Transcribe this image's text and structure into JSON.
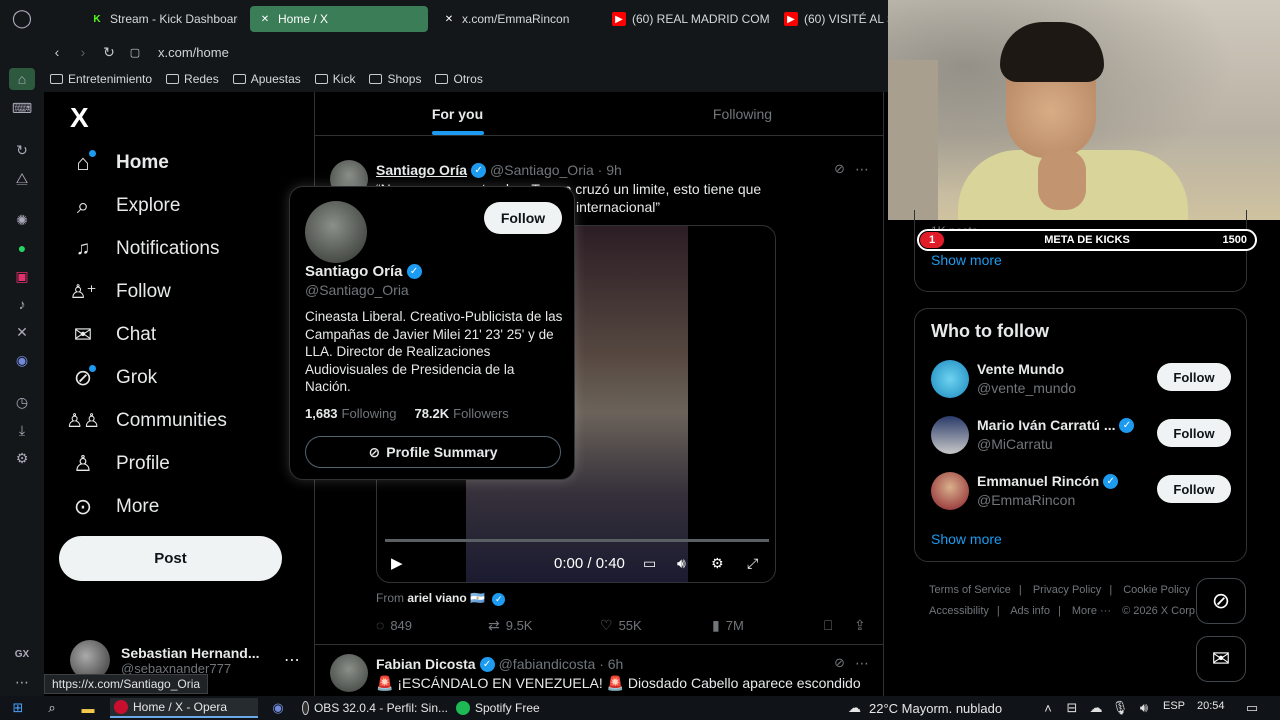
{
  "browser": {
    "tabs": [
      {
        "label": "Stream - Kick Dashboard",
        "icon": "kick-icon",
        "color": "#53fc18"
      },
      {
        "label": "Home / X",
        "icon": "x-icon",
        "color": "#ffffff"
      },
      {
        "label": "x.com/EmmaRincon",
        "icon": "x-icon",
        "color": "#ffffff"
      },
      {
        "label": "(60) REAL MADRID COM",
        "icon": "youtube-icon",
        "color": "#ff0000"
      },
      {
        "label": "(60) VISITÉ AL S",
        "icon": "youtube-icon",
        "color": "#ff0000"
      }
    ],
    "url": "x.com/home",
    "bookmarks": [
      "Entretenimiento",
      "Redes",
      "Apuestas",
      "Kick",
      "Shops",
      "Otros"
    ],
    "status_url": "https://x.com/Santiago_Oria"
  },
  "nav": {
    "logo": "X",
    "items": [
      {
        "label": "Home",
        "icon": "home-icon",
        "glyph": "⌂"
      },
      {
        "label": "Explore",
        "icon": "search-icon",
        "glyph": "⌕"
      },
      {
        "label": "Notifications",
        "icon": "bell-icon",
        "glyph": "🔔︎"
      },
      {
        "label": "Follow",
        "icon": "person-add-icon",
        "glyph": "👤︎"
      },
      {
        "label": "Chat",
        "icon": "mail-icon",
        "glyph": "✉"
      },
      {
        "label": "Grok",
        "icon": "grok-icon",
        "glyph": "⊘"
      },
      {
        "label": "Communities",
        "icon": "communities-icon",
        "glyph": "👥︎"
      },
      {
        "label": "Profile",
        "icon": "profile-icon",
        "glyph": "👤︎"
      },
      {
        "label": "More",
        "icon": "more-circle-icon",
        "glyph": "⋯"
      }
    ],
    "post_button": "Post",
    "account": {
      "name": "Sebastian Hernand...",
      "handle": "@sebaxnander777"
    }
  },
  "feed": {
    "tabs": [
      "For you",
      "Following"
    ],
    "post1": {
      "name": "Santiago Oría",
      "handle": "@Santiago_Oria · 9h",
      "text_line1": "“No se vos no entendes. Trump cruzó un limite, esto tiene que",
      "text_line2": "internacional”",
      "video_time": "0:00 / 0:40",
      "source_label": "From",
      "source_name": "ariel viano 🇦🇷",
      "replies": "849",
      "reposts": "9.5K",
      "likes": "55K",
      "views": "7M"
    },
    "post2": {
      "name": "Fabian Dicosta",
      "handle": "@fabiandicosta · 6h",
      "text": "🚨 ¡ESCÁNDALO EN VENEZUELA! 🚨 Diosdado Cabello aparece escondido"
    }
  },
  "hover_card": {
    "follow": "Follow",
    "name": "Santiago Oría",
    "handle": "@Santiago_Oria",
    "bio": "Cineasta Liberal. Creativo-Publicista de las Campañas de Javier Milei 21' 23' 25' y de LLA. Director de Realizaciones Audiovisuales de Presidencia de la Nación.",
    "following_count": "1,683",
    "following_label": "Following",
    "followers_count": "78.2K",
    "followers_label": "Followers",
    "summary_button": "Profile Summary"
  },
  "sidebar": {
    "kick_overlay": {
      "current": "1",
      "title": "META DE KICKS",
      "goal": "1500",
      "progress": 0.0007
    },
    "trend_posts_fragment": "1K posts",
    "trend_show_more": "Show more",
    "who_to_follow": {
      "title": "Who to follow",
      "people": [
        {
          "name": "Vente Mundo",
          "handle": "@vente_mundo",
          "verified": false,
          "follow": "Follow"
        },
        {
          "name": "Mario Iván Carratú ...",
          "handle": "@MiCarratu",
          "verified": true,
          "follow": "Follow"
        },
        {
          "name": "Emmanuel Rincón",
          "handle": "@EmmaRincon",
          "verified": true,
          "follow": "Follow"
        }
      ],
      "show_more": "Show more"
    },
    "footer": [
      "Terms of Service",
      "|",
      "Privacy Policy",
      "|",
      "Cookie Policy",
      "|",
      "Accessibility",
      "|",
      "Ads info",
      "|",
      "More ···",
      "© 2026 X Corp."
    ]
  },
  "taskbar": {
    "apps": [
      "Home / X - Opera",
      "OBS 32.0.4 - Perfil: Sin...",
      "Spotify Free"
    ],
    "weather": "22°C  Mayorm. nublado",
    "lang": "ESP",
    "time": "20:54"
  },
  "colors": {
    "accent": "#1d9bf0",
    "kick_red": "#e21d2a",
    "opera_tab": "#3a7d57"
  }
}
